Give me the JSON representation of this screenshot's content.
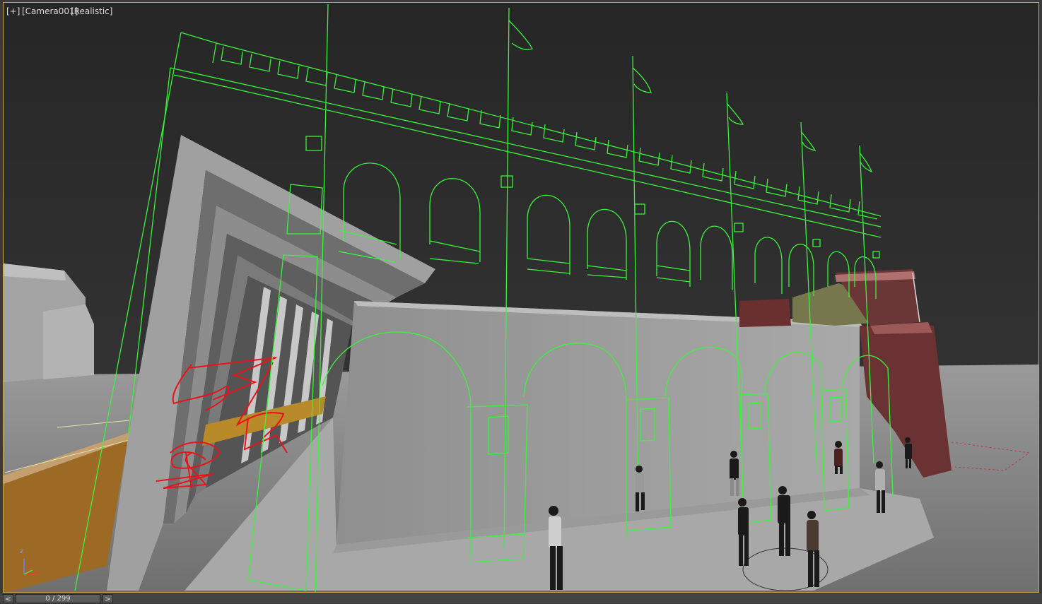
{
  "viewport": {
    "labels": [
      "[+]",
      "[Camera001]",
      "[Realistic]"
    ]
  },
  "timeline": {
    "prev_label": "<",
    "next_label": ">",
    "frame_display": "0 / 299"
  },
  "gizmo": {
    "x_label": "x",
    "z_label": "z"
  },
  "colors": {
    "wire": "#3cf23c",
    "sketch": "#e8141a",
    "sky": "#2b2b2b",
    "ground": "#8a8a8a",
    "border": "#c9a44a"
  }
}
